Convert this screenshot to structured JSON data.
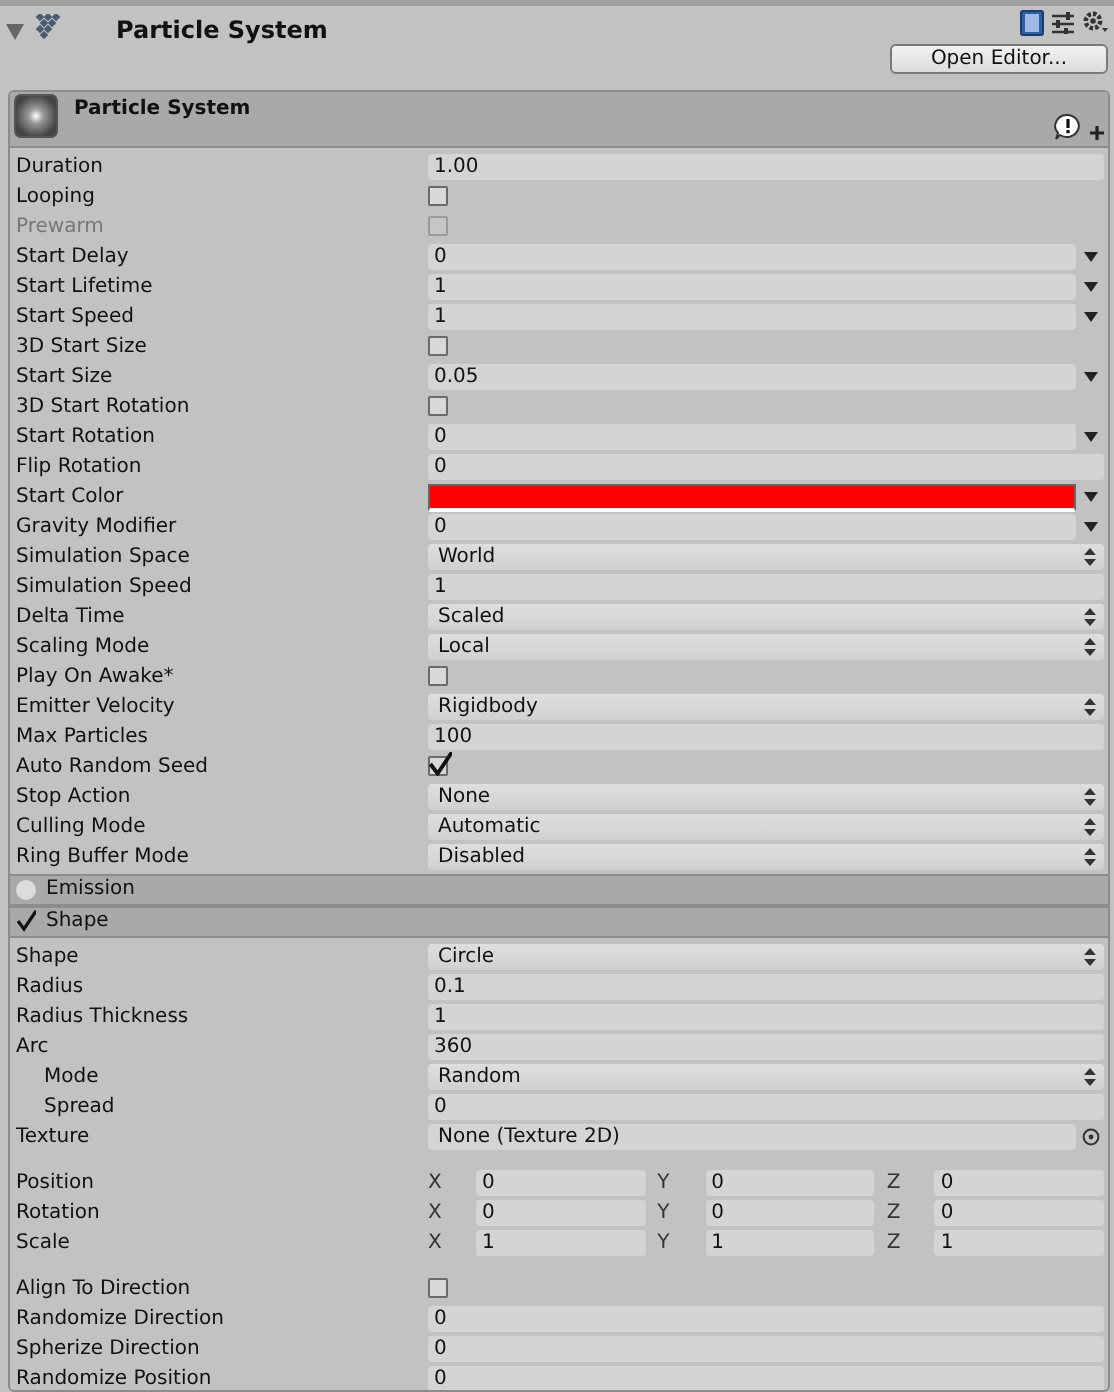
{
  "inspector": {
    "title": "Particle System",
    "open_editor_button": "Open Editor..."
  },
  "component": {
    "title": "Particle System",
    "rows": [
      {
        "label": "Duration",
        "kind": "field",
        "value": "1.00"
      },
      {
        "label": "Looping",
        "kind": "check",
        "checked": false,
        "disabled": false
      },
      {
        "label": "Prewarm",
        "kind": "check",
        "checked": false,
        "disabled": true
      },
      {
        "label": "Start Delay",
        "kind": "curve",
        "value": "0"
      },
      {
        "label": "Start Lifetime",
        "kind": "curve",
        "value": "1"
      },
      {
        "label": "Start Speed",
        "kind": "curve",
        "value": "1"
      },
      {
        "label": "3D Start Size",
        "kind": "check",
        "checked": false,
        "disabled": false
      },
      {
        "label": "Start Size",
        "kind": "curve",
        "value": "0.05"
      },
      {
        "label": "3D Start Rotation",
        "kind": "check",
        "checked": false,
        "disabled": false
      },
      {
        "label": "Start Rotation",
        "kind": "curve",
        "value": "0"
      },
      {
        "label": "Flip Rotation",
        "kind": "field",
        "value": "0"
      },
      {
        "label": "Start Color",
        "kind": "color",
        "color": "#ff0000"
      },
      {
        "label": "Gravity Modifier",
        "kind": "curve",
        "value": "0"
      },
      {
        "label": "Simulation Space",
        "kind": "select",
        "value": "World"
      },
      {
        "label": "Simulation Speed",
        "kind": "field",
        "value": "1"
      },
      {
        "label": "Delta Time",
        "kind": "select",
        "value": "Scaled"
      },
      {
        "label": "Scaling Mode",
        "kind": "select",
        "value": "Local"
      },
      {
        "label": "Play On Awake*",
        "kind": "check",
        "checked": false,
        "disabled": false
      },
      {
        "label": "Emitter Velocity",
        "kind": "select",
        "value": "Rigidbody"
      },
      {
        "label": "Max Particles",
        "kind": "field",
        "value": "100"
      },
      {
        "label": "Auto Random Seed",
        "kind": "check",
        "checked": true,
        "disabled": false
      },
      {
        "label": "Stop Action",
        "kind": "select",
        "value": "None"
      },
      {
        "label": "Culling Mode",
        "kind": "select",
        "value": "Automatic"
      },
      {
        "label": "Ring Buffer Mode",
        "kind": "select",
        "value": "Disabled"
      }
    ]
  },
  "modules": [
    {
      "title": "Emission",
      "enabled": false
    },
    {
      "title": "Shape",
      "enabled": true,
      "groups": [
        [
          {
            "label": "Shape",
            "kind": "select",
            "value": "Circle"
          },
          {
            "label": "Radius",
            "kind": "field",
            "value": "0.1"
          },
          {
            "label": "Radius Thickness",
            "kind": "field",
            "value": "1"
          },
          {
            "label": "Arc",
            "kind": "field",
            "value": "360",
            "children": [
              {
                "label": "Mode",
                "kind": "select",
                "value": "Random"
              },
              {
                "label": "Spread",
                "kind": "field",
                "value": "0"
              }
            ]
          },
          {
            "label": "Texture",
            "kind": "object",
            "value": "None (Texture 2D)"
          }
        ],
        [
          {
            "label": "Position",
            "kind": "vector3",
            "components": [
              {
                "axis": "X",
                "value": "0"
              },
              {
                "axis": "Y",
                "value": "0"
              },
              {
                "axis": "Z",
                "value": "0"
              }
            ]
          },
          {
            "label": "Rotation",
            "kind": "vector3",
            "components": [
              {
                "axis": "X",
                "value": "0"
              },
              {
                "axis": "Y",
                "value": "0"
              },
              {
                "axis": "Z",
                "value": "0"
              }
            ]
          },
          {
            "label": "Scale",
            "kind": "vector3",
            "components": [
              {
                "axis": "X",
                "value": "1"
              },
              {
                "axis": "Y",
                "value": "1"
              },
              {
                "axis": "Z",
                "value": "1"
              }
            ]
          }
        ],
        [
          {
            "label": "Align To Direction",
            "kind": "check",
            "checked": false,
            "disabled": false
          },
          {
            "label": "Randomize Direction",
            "kind": "field",
            "value": "0"
          },
          {
            "label": "Spherize Direction",
            "kind": "field",
            "value": "0"
          },
          {
            "label": "Randomize Position",
            "kind": "field",
            "value": "0"
          }
        ]
      ]
    }
  ]
}
